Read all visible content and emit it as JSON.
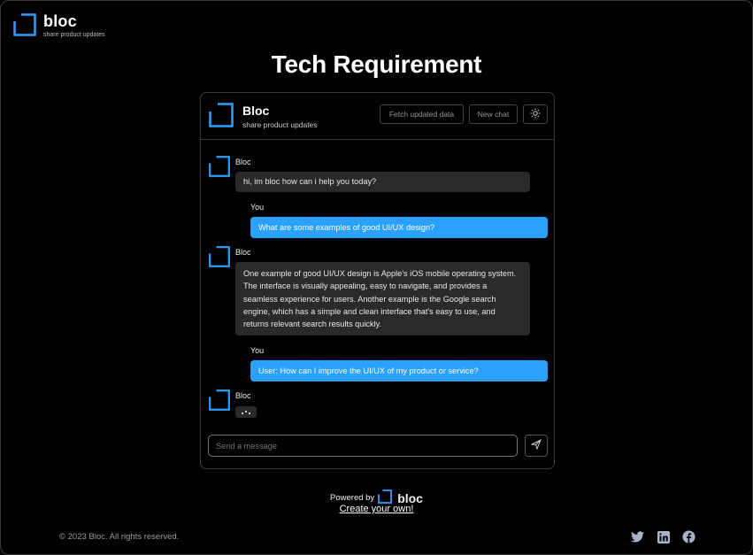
{
  "brand": {
    "name": "bloc",
    "tagline": "share product updates",
    "accent": "#2aa0ff"
  },
  "page": {
    "title": "Tech Requirement"
  },
  "chat": {
    "header": {
      "name": "Bloc",
      "tagline": "share product updates",
      "fetch_button": "Fetch updated data",
      "new_chat_button": "New chat",
      "theme_icon": "sun-icon"
    },
    "messages": [
      {
        "sender": "Bloc",
        "text": "hi, im bloc how can i help you today?"
      },
      {
        "sender": "You",
        "text": "What are some examples of good UI/UX design?"
      },
      {
        "sender": "Bloc",
        "text": "One example of good UI/UX design is Apple's iOS mobile operating system. The interface is visually appealing, easy to navigate, and provides a seamless experience for users. Another example is the Google search engine, which has a simple and clean interface that's easy to use, and returns relevant search results quickly."
      },
      {
        "sender": "You",
        "text": "User: How can I improve the UI/UX of my product or service?"
      },
      {
        "sender": "Bloc",
        "text": ""
      }
    ],
    "input": {
      "placeholder": "Send a message",
      "value": ""
    },
    "send_icon": "send-icon"
  },
  "footer": {
    "powered_by": "Powered by",
    "powered_brand": "bloc",
    "create_link": "Create your own!",
    "copyright": "© 2023 Bloc. All rights reserved.",
    "socials": [
      "twitter-icon",
      "linkedin-icon",
      "facebook-icon"
    ]
  }
}
